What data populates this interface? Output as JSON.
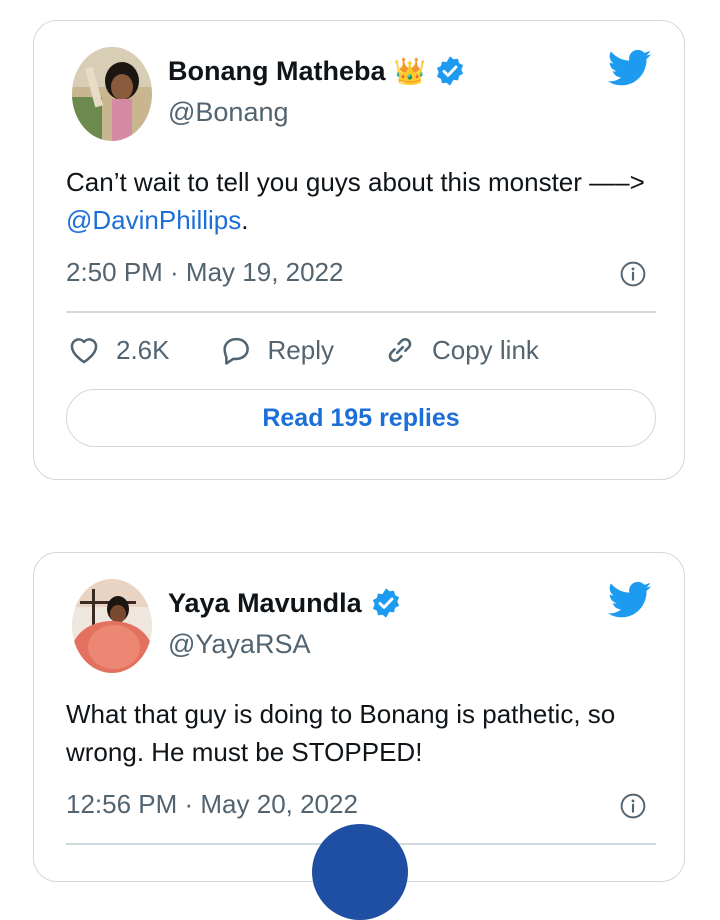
{
  "tweets": [
    {
      "author": "Bonang Matheba",
      "emoji": "👑",
      "handle": "@Bonang",
      "text_before": "Can’t wait to tell you guys about this monster —–> ",
      "mention": "@DavinPhillips",
      "text_after": ".",
      "timestamp": "2:50 PM · May 19, 2022",
      "likes": "2.6K",
      "reply_label": "Reply",
      "copy_label": "Copy link",
      "read_replies": "Read 195 replies"
    },
    {
      "author": "Yaya Mavundla",
      "handle": "@YayaRSA",
      "text": "What that guy is doing to Bonang is pathetic, so wrong. He must be STOPPED!",
      "timestamp": "12:56 PM · May 20, 2022"
    }
  ],
  "colors": {
    "twitter_blue": "#1d9bf0",
    "link_blue": "#1d6fd8",
    "muted": "#536471",
    "border": "#cfd9de"
  },
  "icons": [
    "twitter-bird-icon",
    "verified-badge-icon",
    "info-icon",
    "heart-icon",
    "reply-icon",
    "link-icon"
  ]
}
